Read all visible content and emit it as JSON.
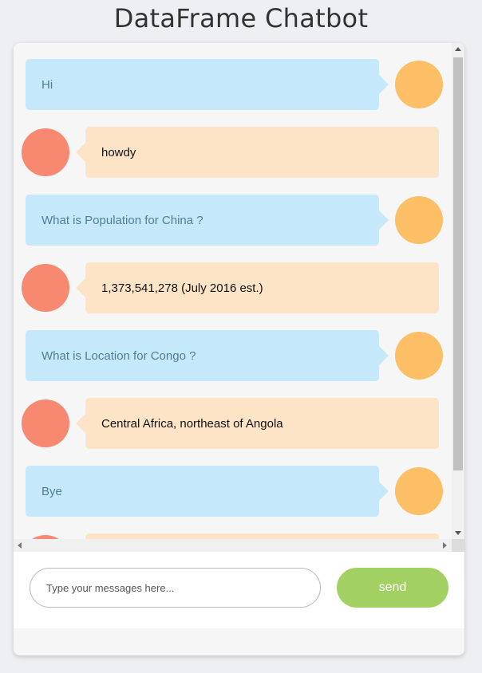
{
  "header": {
    "title": "DataFrame Chatbot"
  },
  "messages": [
    {
      "sender": "user",
      "text": "Hi"
    },
    {
      "sender": "bot",
      "text": "howdy"
    },
    {
      "sender": "user",
      "text": "What is Population for China ?"
    },
    {
      "sender": "bot",
      "text": "1,373,541,278 (July 2016 est.)"
    },
    {
      "sender": "user",
      "text": "What is Location for Congo ?"
    },
    {
      "sender": "bot",
      "text": "Central Africa, northeast of Angola"
    },
    {
      "sender": "user",
      "text": "Bye"
    },
    {
      "sender": "bot",
      "text": ""
    }
  ],
  "composer": {
    "placeholder": "Type your messages here...",
    "value": "",
    "send_label": "send"
  },
  "colors": {
    "user_bubble": "#c5e8fa",
    "bot_bubble": "#fde4c7",
    "user_avatar": "#fdbf65",
    "bot_avatar": "#f6896f",
    "send_button": "#a3d063"
  }
}
